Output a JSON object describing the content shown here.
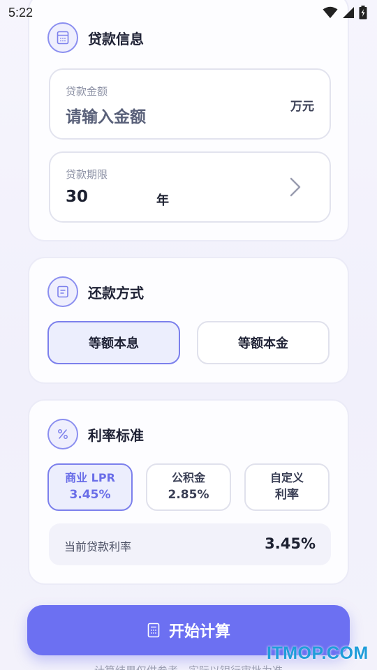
{
  "status_bar": {
    "time": "5:22"
  },
  "loan_info": {
    "title": "贷款信息",
    "icon": "calculator-icon",
    "amount": {
      "label": "贷款金额",
      "placeholder": "请输入金额",
      "unit": "万元"
    },
    "term": {
      "label": "贷款期限",
      "value": "30",
      "unit": "年"
    }
  },
  "repayment": {
    "title": "还款方式",
    "icon": "document-icon",
    "options": [
      {
        "label": "等额本息",
        "selected": true
      },
      {
        "label": "等额本金",
        "selected": false
      }
    ]
  },
  "rate": {
    "title": "利率标准",
    "icon": "percent-icon",
    "options": [
      {
        "name": "商业 LPR",
        "value": "3.45%",
        "selected": true
      },
      {
        "name": "公积金",
        "value": "2.85%",
        "selected": false
      },
      {
        "name": "自定义",
        "value": "利率",
        "selected": false
      }
    ],
    "current_label": "当前贷款利率",
    "current_value": "3.45%"
  },
  "calculate_button": {
    "label": "开始计算",
    "icon": "calculator-icon"
  },
  "disclaimer": "计算结果仅供参考，实际以银行审批为准",
  "watermark": "ITMOP.COM",
  "colors": {
    "accent": "#6c70f2",
    "selected_bg": "#eceefd",
    "selected_border": "#7c80ec"
  }
}
